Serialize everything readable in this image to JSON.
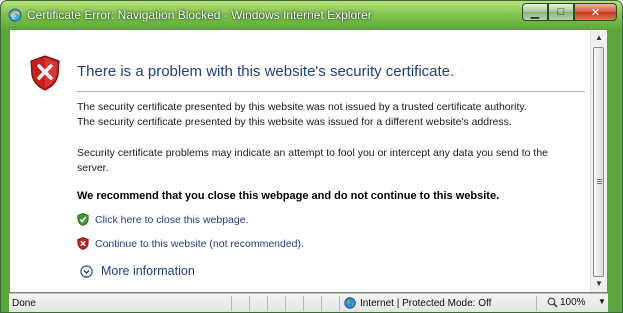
{
  "window": {
    "title": "Certificate Error: Navigation Blocked - Windows Internet Explorer",
    "minimize_glyph": "▁",
    "maximize_glyph": "□",
    "close_glyph": "✕"
  },
  "page": {
    "heading": "There is a problem with this website's security certificate.",
    "paragraph1_line1": "The security certificate presented by this website was not issued by a trusted certificate authority.",
    "paragraph1_line2": "The security certificate presented by this website was issued for a different website's address.",
    "paragraph2": "Security certificate problems may indicate an attempt to fool you or intercept any data you send to the server.",
    "recommendation": "We recommend that you close this webpage and do not continue to this website.",
    "close_link": "Click here to close this webpage.",
    "continue_link": "Continue to this website (not recommended).",
    "more_info": "More information"
  },
  "statusbar": {
    "status": "Done",
    "zone": "Internet | Protected Mode: Off",
    "zoom": "100%"
  },
  "icons": {
    "title_icon": "ie-logo-icon",
    "main_icon": "shield-error-icon",
    "close_link_icon": "shield-ok-icon",
    "continue_link_icon": "shield-warning-icon",
    "more_info_icon": "chevron-down-circle-icon",
    "zone_icon": "globe-icon",
    "zoom_icon": "magnifier-icon"
  }
}
